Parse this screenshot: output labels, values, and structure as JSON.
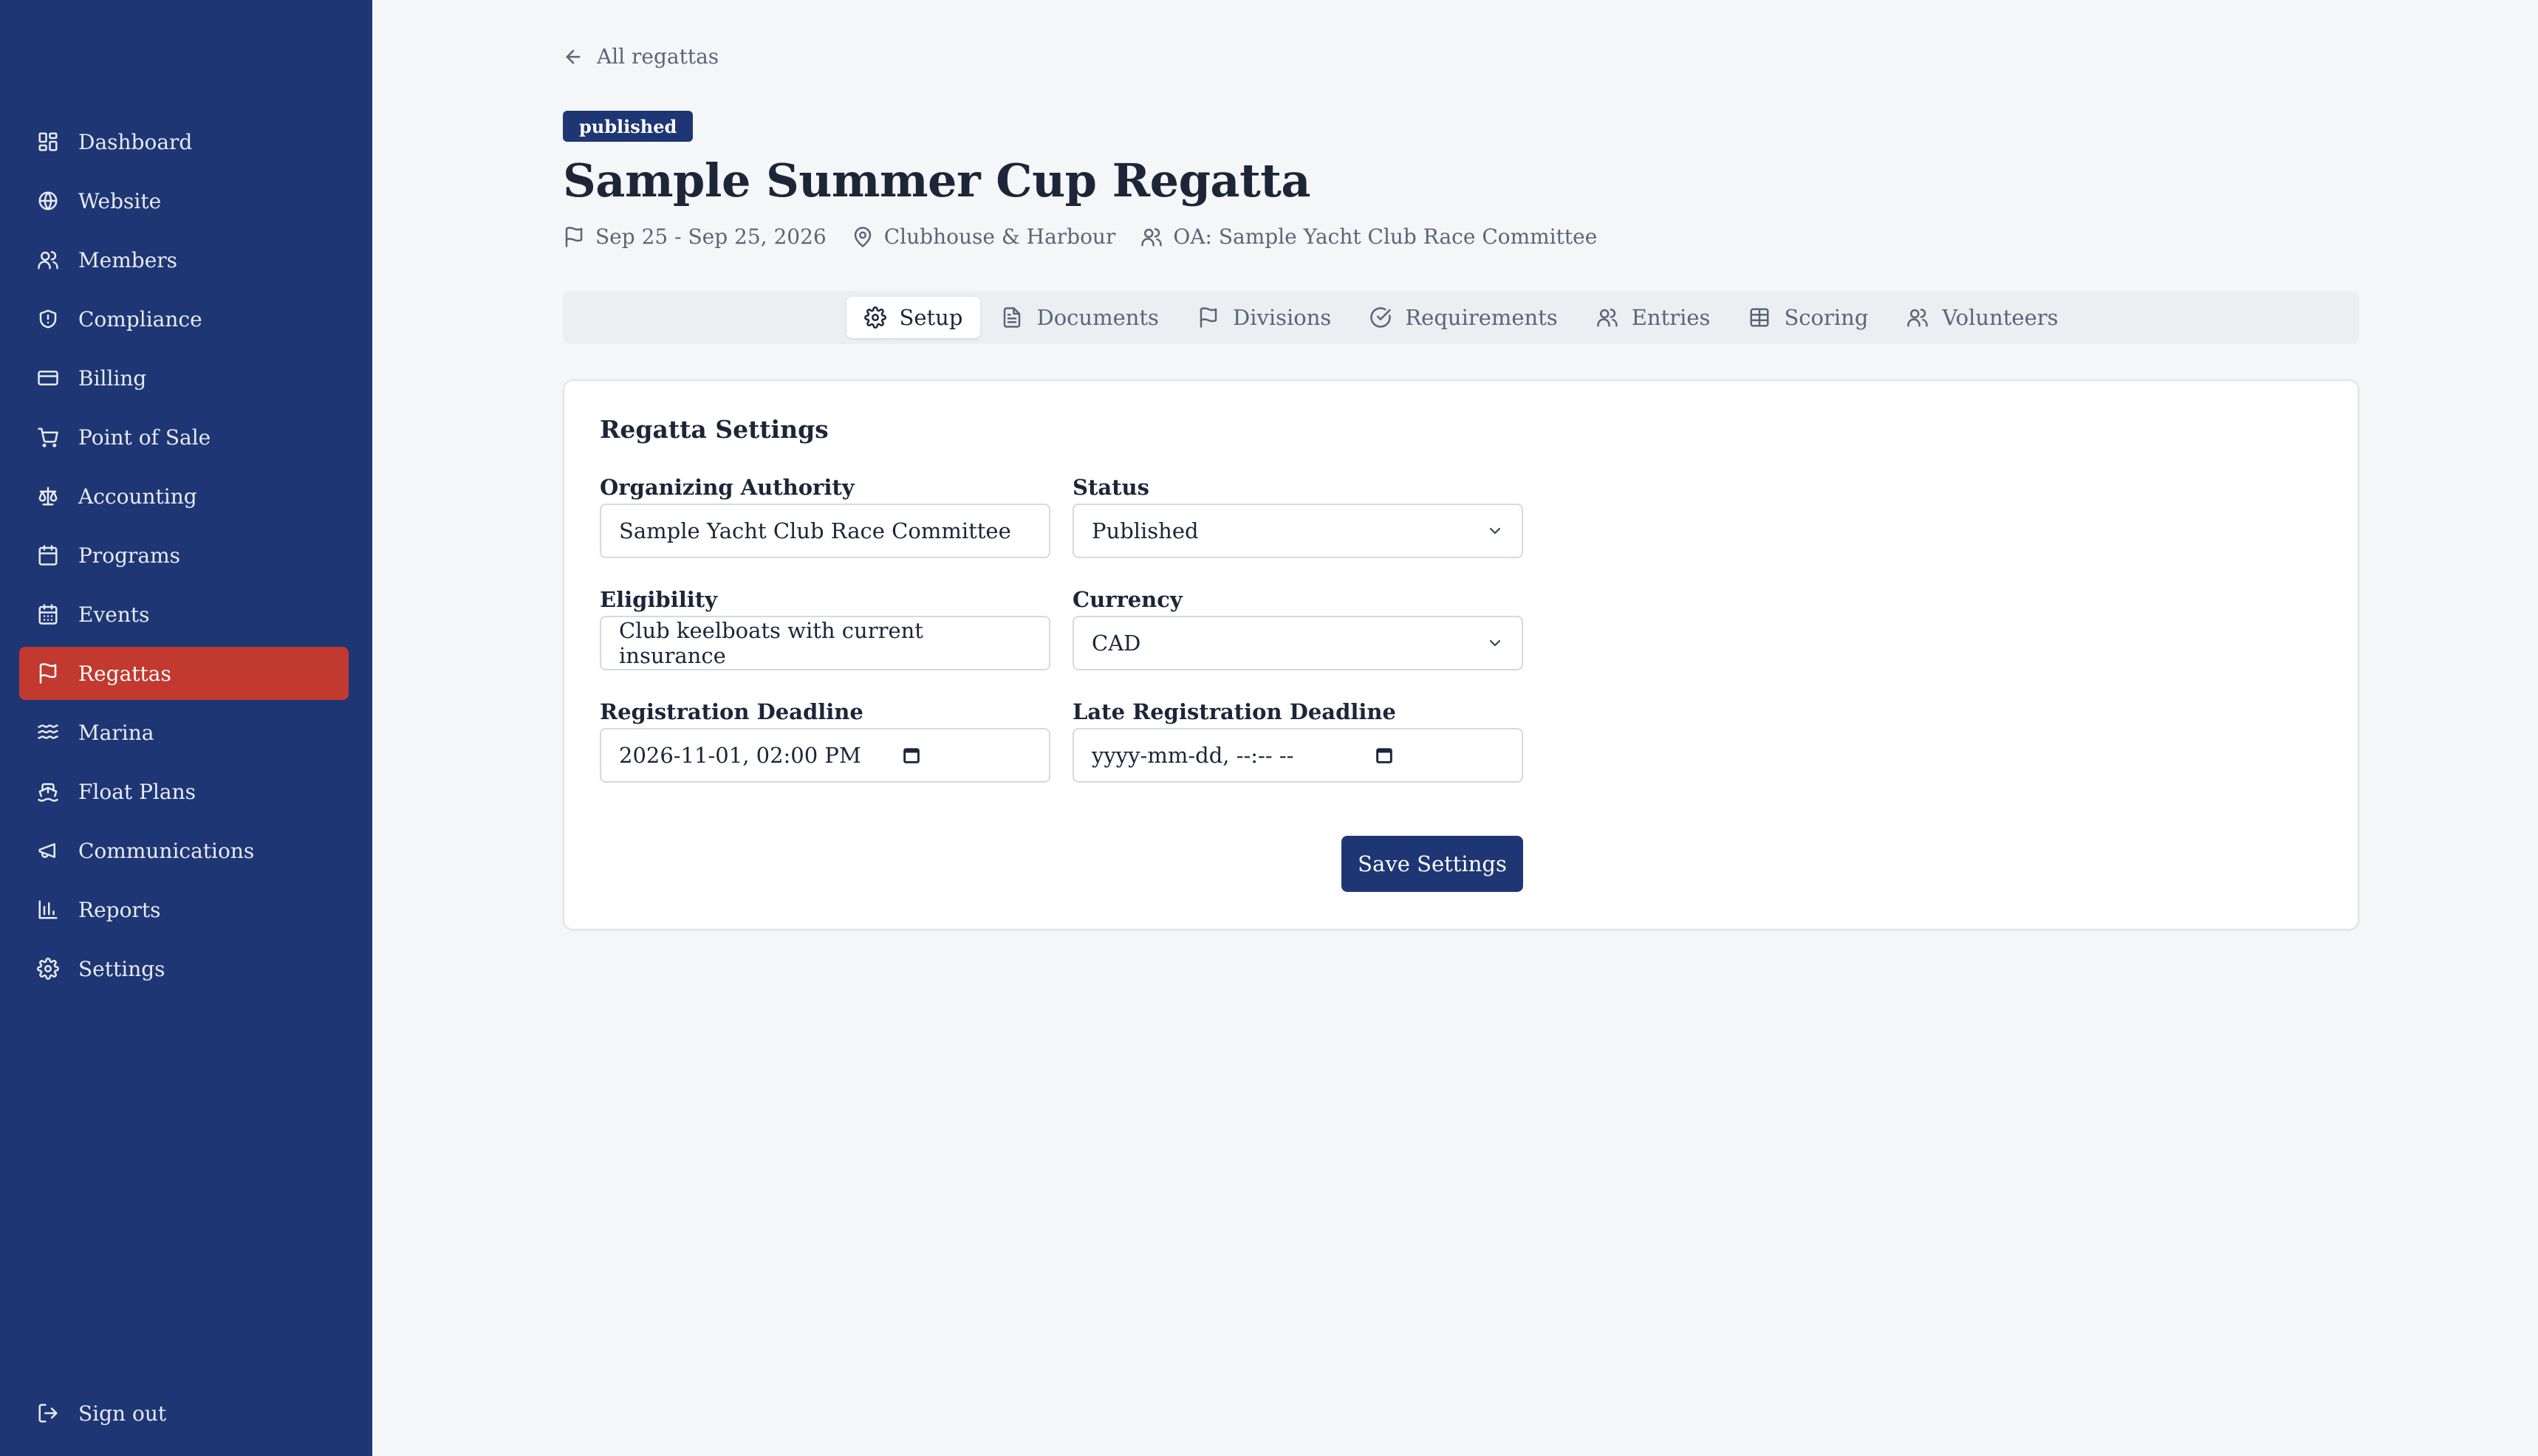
{
  "sidebar": {
    "items": [
      {
        "label": "Dashboard",
        "icon": "dashboard-icon"
      },
      {
        "label": "Website",
        "icon": "globe-icon"
      },
      {
        "label": "Members",
        "icon": "users-icon"
      },
      {
        "label": "Compliance",
        "icon": "shield-icon"
      },
      {
        "label": "Billing",
        "icon": "credit-card-icon"
      },
      {
        "label": "Point of Sale",
        "icon": "cart-icon"
      },
      {
        "label": "Accounting",
        "icon": "scale-icon"
      },
      {
        "label": "Programs",
        "icon": "calendar-icon"
      },
      {
        "label": "Events",
        "icon": "calendar-days-icon"
      },
      {
        "label": "Regattas",
        "icon": "flag-icon",
        "active": true
      },
      {
        "label": "Marina",
        "icon": "waves-icon"
      },
      {
        "label": "Float Plans",
        "icon": "ship-icon"
      },
      {
        "label": "Communications",
        "icon": "megaphone-icon"
      },
      {
        "label": "Reports",
        "icon": "bar-chart-icon"
      },
      {
        "label": "Settings",
        "icon": "gear-icon"
      }
    ],
    "signout": "Sign out",
    "active_color": "#c2392f",
    "bg_color": "#1e3673"
  },
  "header": {
    "back_label": "All regattas",
    "status_badge": "published",
    "title": "Sample Summer Cup Regatta",
    "dates": "Sep 25 - Sep 25, 2026",
    "location": "Clubhouse & Harbour",
    "oa": "OA: Sample Yacht Club Race Committee"
  },
  "tabs": [
    {
      "label": "Setup",
      "icon": "gear-icon",
      "active": true
    },
    {
      "label": "Documents",
      "icon": "document-icon"
    },
    {
      "label": "Divisions",
      "icon": "flag-icon"
    },
    {
      "label": "Requirements",
      "icon": "check-circle-icon"
    },
    {
      "label": "Entries",
      "icon": "users-icon"
    },
    {
      "label": "Scoring",
      "icon": "table-icon"
    },
    {
      "label": "Volunteers",
      "icon": "users-icon"
    }
  ],
  "settings": {
    "title": "Regatta Settings",
    "organizing_authority": {
      "label": "Organizing Authority",
      "value": "Sample Yacht Club Race Committee"
    },
    "status": {
      "label": "Status",
      "value": "Published"
    },
    "eligibility": {
      "label": "Eligibility",
      "value": "Club keelboats with current insurance"
    },
    "currency": {
      "label": "Currency",
      "value": "CAD"
    },
    "registration_deadline": {
      "label": "Registration Deadline",
      "value": "2026-11-01, 02:00 PM"
    },
    "late_registration_deadline": {
      "label": "Late Registration Deadline",
      "value": "yyyy-mm-dd, --:-- --"
    },
    "save_label": "Save Settings"
  }
}
